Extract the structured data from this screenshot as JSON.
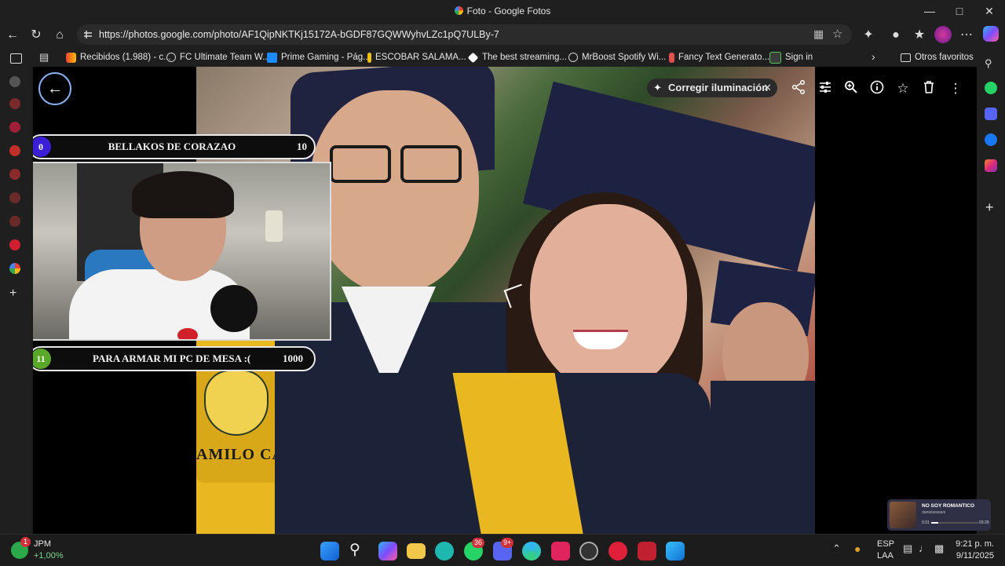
{
  "window": {
    "title": "Foto - Google Fotos",
    "title_icon": "google-photos-icon"
  },
  "address": {
    "url": "https://photos.google.com/photo/AF1QipNKTKj15172A-bGDF87GQWWyhvLZc1pQ7ULBy-7"
  },
  "bookmarks": {
    "items": [
      {
        "label": "Recibidos (1.988) - c...",
        "color": "#ffffff"
      },
      {
        "label": "FC Ultimate Team W...",
        "color": "#cfcfcf"
      },
      {
        "label": "Prime Gaming - Pág...",
        "color": "#1a8cff"
      },
      {
        "label": "ESCOBAR SALAMA...",
        "color": "#f2c200"
      },
      {
        "label": "The best streaming...",
        "color": "#ffffff"
      },
      {
        "label": "MrBoost Spotify Wi...",
        "color": "#cfcfcf"
      },
      {
        "label": "Fancy Text Generato...",
        "color": "#e25050"
      },
      {
        "label": "Sign in",
        "color": "#3c3c3c"
      }
    ],
    "other": "Otros favoritos"
  },
  "viewer": {
    "fix_light": "Corregir iluminación",
    "tools": [
      "share-icon",
      "edit-adjust-icon",
      "zoom-icon",
      "info-icon",
      "star-icon",
      "trash-icon",
      "more-icon"
    ]
  },
  "overlay": {
    "goal_top": {
      "number": "0",
      "text": "BELLAKOS DE CORAZAO",
      "target": "10",
      "accent": "#3b1fd6"
    },
    "goal_bottom": {
      "number": "11",
      "text": "PARA ARMAR MI PC DE MESA :(",
      "target": "1000",
      "accent": "#5aa82a"
    }
  },
  "photo": {
    "banner_text": "AMILO CASALLAS"
  },
  "taskbar": {
    "stock": {
      "name": "JPM",
      "change": "+1,00%",
      "badge": "1"
    },
    "badges": {
      "whatsapp": "36",
      "discord": "9+"
    },
    "lang": "ESP",
    "layout": "LAA",
    "time": "9:21 p. m.",
    "date": "9/11/2025"
  },
  "miniplayer": {
    "title": "NO SOY ROMANTICO",
    "artist": "danielaswave",
    "elapsed": "0:31",
    "total": "03:29",
    "progress": 0.15
  }
}
